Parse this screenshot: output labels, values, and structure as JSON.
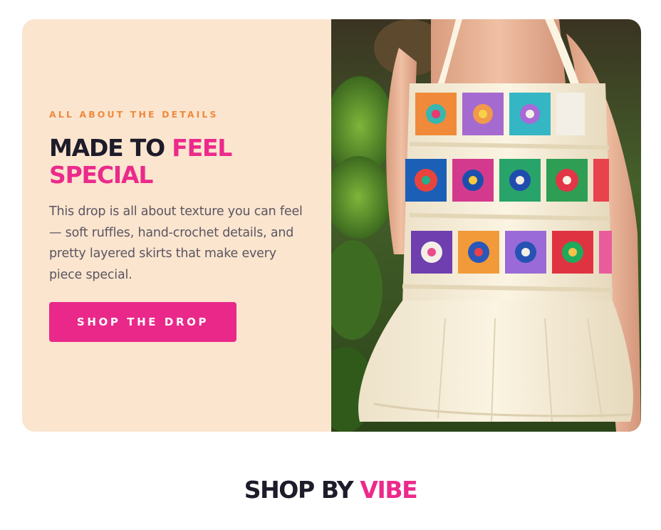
{
  "hero": {
    "eyebrow": "ALL ABOUT THE DETAILS",
    "headline_part1": "MADE TO ",
    "headline_accent": "FEEL SPECIAL",
    "body": "This drop is all about texture you can feel — soft ruffles, hand-crochet details, and pretty layered skirts that make every piece special.",
    "cta_label": "SHOP THE DROP",
    "image_icon": "crochet-top-photo"
  },
  "section": {
    "title_part1": "SHOP BY ",
    "title_accent": "VIBE"
  },
  "colors": {
    "panel_bg": "#fbe5cf",
    "eyebrow": "#ef8a3e",
    "accent_pink": "#e9288a",
    "heading_dark": "#1e1b2a",
    "body_text": "#5b5560"
  }
}
